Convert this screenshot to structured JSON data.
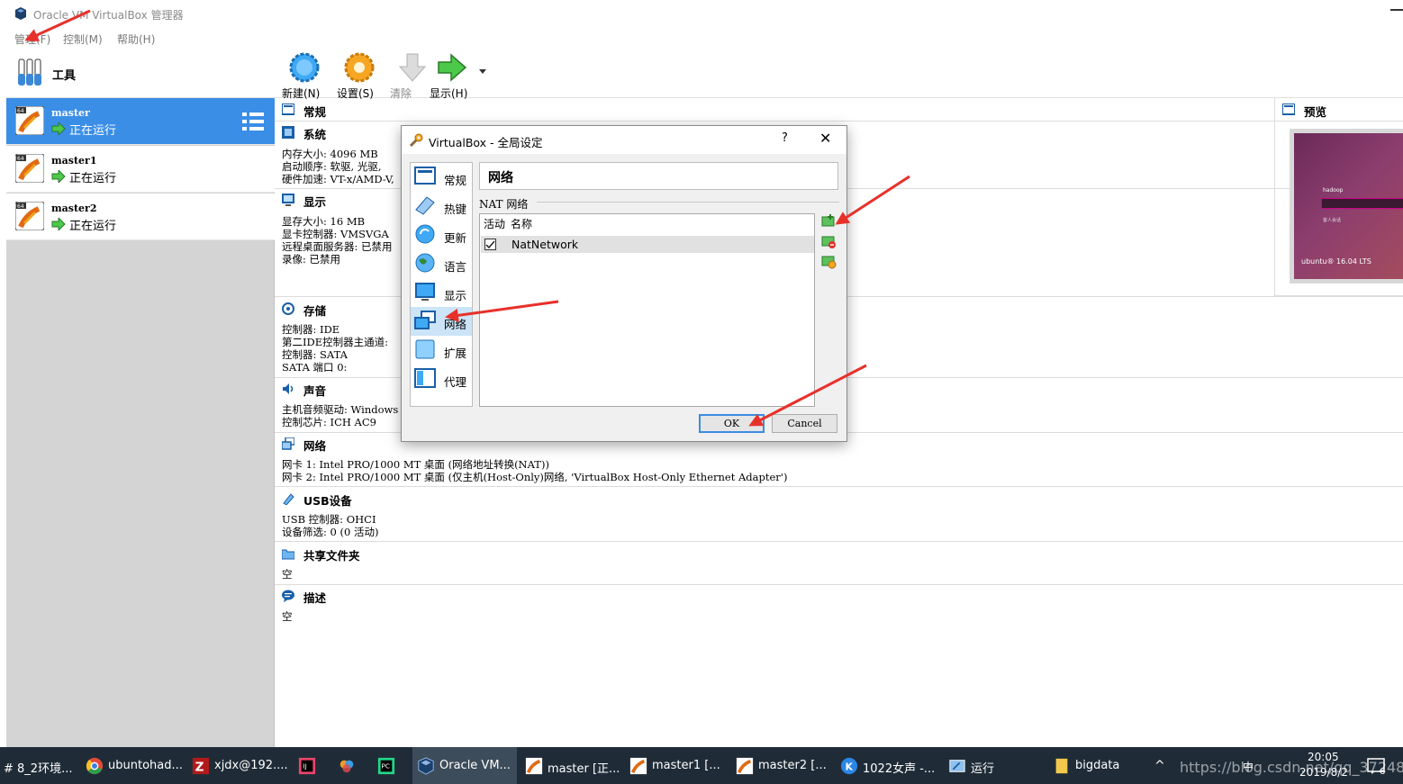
{
  "window": {
    "title": "Oracle VM VirtualBox 管理器"
  },
  "menu": [
    "管理(F)",
    "控制(M)",
    "帮助(H)"
  ],
  "tools": {
    "label": "工具"
  },
  "vms": [
    {
      "name": "master",
      "state": "正在运行",
      "selected": true
    },
    {
      "name": "master1",
      "state": "正在运行",
      "selected": false
    },
    {
      "name": "master2",
      "state": "正在运行",
      "selected": false
    }
  ],
  "toolbar": {
    "new": "新建(N)",
    "settings": "设置(S)",
    "discard": "清除",
    "show": "显示(H)"
  },
  "details": {
    "general": {
      "title": "常规"
    },
    "system": {
      "title": "系统",
      "lines": [
        "内存大小:  4096 MB",
        "启动顺序:  软驱, 光驱,",
        "硬件加速:  VT-x/AMD-V,"
      ]
    },
    "display": {
      "title": "显示",
      "lines": [
        "显存大小:       16 MB",
        "显卡控制器:     VMSVGA",
        "远程桌面服务器: 已禁用",
        "录像:           已禁用"
      ]
    },
    "storage": {
      "title": "存储",
      "lines": [
        "控制器: IDE",
        "  第二IDE控制器主通道:",
        "控制器: SATA",
        "  SATA 端口 0:"
      ]
    },
    "audio": {
      "title": "声音",
      "lines": [
        "主机音频驱动:  Windows",
        "控制芯片:      ICH AC9"
      ]
    },
    "network": {
      "title": "网络",
      "lines": [
        "网卡 1:  Intel PRO/1000 MT 桌面 (网络地址转换(NAT))",
        "网卡 2:  Intel PRO/1000 MT 桌面 (仅主机(Host-Only)网络, 'VirtualBox Host-Only Ethernet Adapter')"
      ]
    },
    "usb": {
      "title": "USB设备",
      "lines": [
        "USB 控制器:  OHCI",
        "设备筛选:    0 (0 活动)"
      ]
    },
    "shared": {
      "title": "共享文件夹",
      "lines": [
        "空"
      ]
    },
    "description": {
      "title": "描述",
      "lines": [
        "空"
      ]
    }
  },
  "preview": {
    "title": "预览",
    "screen_user": "hadoop",
    "screen_guest": "客人会话",
    "screen_brand": "ubuntu® 16.04 LTS"
  },
  "dialog": {
    "title": "VirtualBox - 全局设定",
    "help": "?",
    "close": "✕",
    "nav": [
      "常规",
      "热键",
      "更新",
      "语言",
      "显示",
      "网络",
      "扩展",
      "代理"
    ],
    "active_nav": "网络",
    "header": "网络",
    "group_label": "NAT 网络",
    "columns": [
      "活动",
      "名称"
    ],
    "rows": [
      {
        "name": "NatNetwork",
        "active": true
      }
    ],
    "ok": "OK",
    "cancel": "Cancel"
  },
  "taskbar": {
    "items": [
      "# 8_2环境...",
      "ubuntohad...",
      "xjdx@192....",
      "",
      "",
      "",
      "Oracle VM...",
      "master [正...",
      "master1 [...",
      "master2 [...",
      "1022女声 -...",
      "运行",
      "bigdata"
    ],
    "tray_time": "20:05",
    "tray_date": "2019/8/2",
    "tray_lang": "中",
    "tray_badge": "6"
  },
  "watermark": "https://blog.csdn.net/qq_37248504",
  "colors": {
    "selected": "#3a8ee6",
    "taskbar": "#1f2c38",
    "accent": "#3d8be0"
  }
}
